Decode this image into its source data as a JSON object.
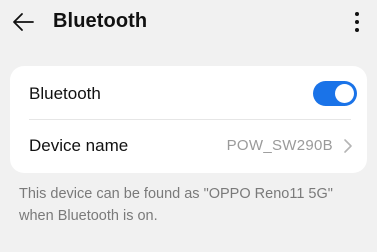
{
  "header": {
    "title": "Bluetooth",
    "back_icon": "arrow-left-icon",
    "more_icon": "more-vertical-icon"
  },
  "settings": {
    "bluetooth": {
      "label": "Bluetooth",
      "enabled": true,
      "toggle_color": "#1a73e8"
    },
    "device_name": {
      "label": "Device name",
      "value": "POW_SW290B",
      "chevron_icon": "chevron-right-icon"
    }
  },
  "footnote": "This device can be found as \"OPPO Reno11 5G\" when Bluetooth is on."
}
